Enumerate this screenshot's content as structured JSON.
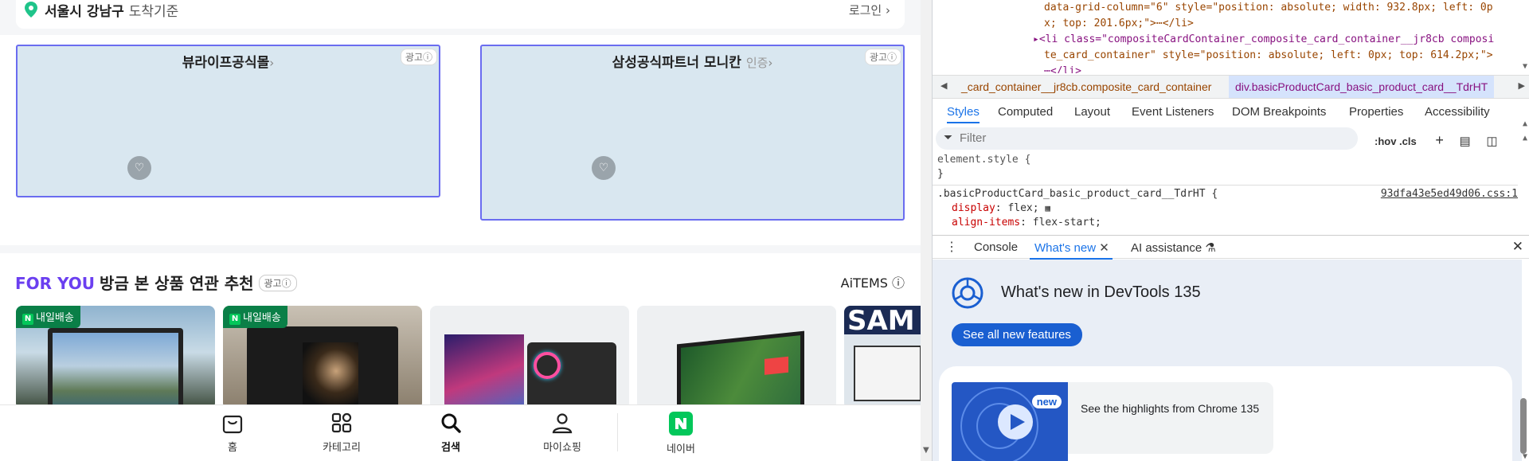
{
  "page": {
    "location": {
      "main": "서울시 강남구",
      "sub": "도착기준"
    },
    "login": "로그인",
    "ads": [
      {
        "title": "뷰라이프공식몰",
        "extra": "",
        "badge": "광고ⓘ"
      },
      {
        "title": "삼성공식파트너 모니칸",
        "extra": "인증",
        "badge": "광고ⓘ"
      }
    ],
    "foryou": {
      "badge": "FOR YOU",
      "title": "방금 본 상품 연관 추천",
      "ad": "광고ⓘ",
      "aitems": "AiTEMS ⓘ",
      "ribbon": "내일배송"
    },
    "tabs": [
      {
        "label": "홈",
        "icon": "bag-icon"
      },
      {
        "label": "카테고리",
        "icon": "grid-icon"
      },
      {
        "label": "검색",
        "icon": "search-icon"
      },
      {
        "label": "마이쇼핑",
        "icon": "person-icon"
      },
      {
        "label": "네이버",
        "icon": "naver-icon"
      }
    ]
  },
  "devtools": {
    "dom_lines": [
      "data-grid-column=\"6\" style=\"position: absolute; width: 932.8px; left: 0p",
      "x; top: 201.6px;\">⋯</li>",
      "▸<li class=\"compositeCardContainer_composite_card_container__jr8cb composi",
      "te_card_container\" style=\"position: absolute; left: 0px; top: 614.2px;\">",
      "⋯</li>"
    ],
    "breadcrumb": [
      "_card_container__jr8cb.composite_card_container",
      "div.basicProductCard_basic_product_card__TdrHT"
    ],
    "panel_tabs": [
      "Styles",
      "Computed",
      "Layout",
      "Event Listeners",
      "DOM Breakpoints",
      "Properties",
      "Accessibility"
    ],
    "filter_placeholder": "Filter",
    "filter_tools": ":hov .cls",
    "styles": {
      "element_style": "element.style {",
      "close": "}",
      "selector": ".basicProductCard_basic_product_card__TdrHT {",
      "source": "93dfa43e5ed49d06.css:1",
      "prop1": "display",
      "val1": "flex;",
      "prop2": "align-items",
      "val2": "flex-start;"
    },
    "drawer_tabs": [
      "Console",
      "What's new",
      "AI assistance"
    ],
    "whatsnew": {
      "title": "What's new in DevTools 135",
      "button": "See all new features",
      "new_badge": "new",
      "highlight": "See the highlights from Chrome 135"
    }
  },
  "colors": {
    "accent": "#6b3ff0",
    "naver": "#03c75a",
    "devtools_blue": "#1a73e8"
  }
}
